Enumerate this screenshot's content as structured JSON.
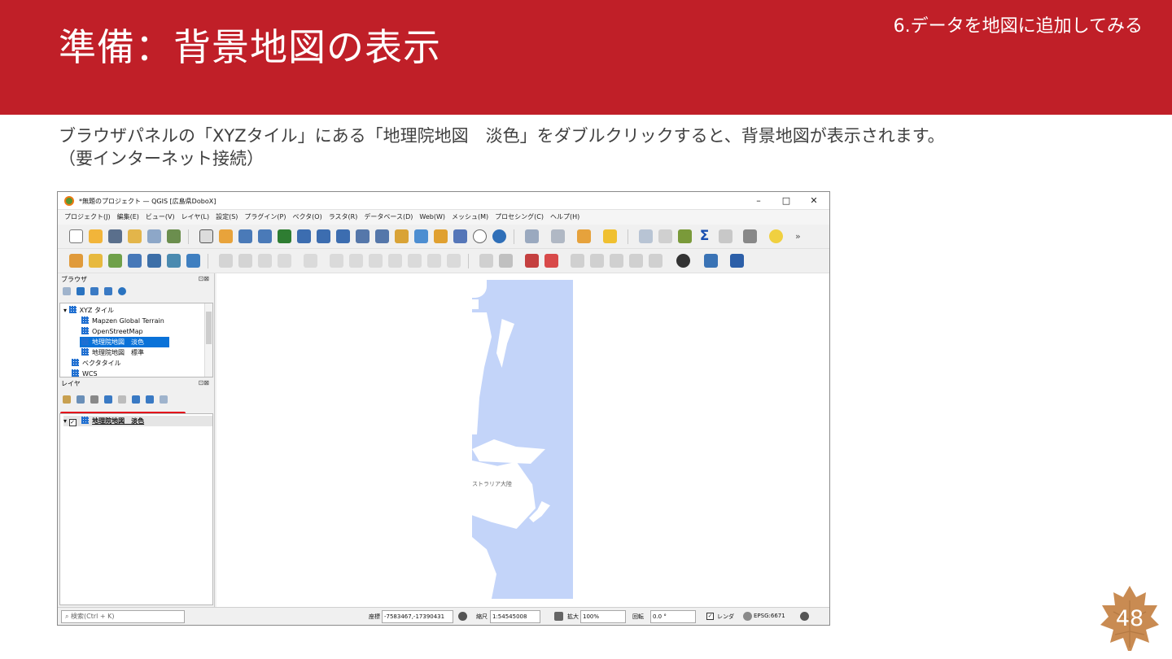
{
  "slide": {
    "title": "準備：背景地図の表示",
    "section": "6.データを地図に追加してみる",
    "description_line1": "ブラウザパネルの「XYZタイル」にある「地理院地図　淡色」をダブルクリックすると、背景地図が表示されます。",
    "description_line2": "（要インターネット接続）",
    "page_number": "48",
    "colors": {
      "header": "#c01f28",
      "badge": "#c98b52",
      "selection": "#0a72d8",
      "highlight_box": "#e3101b",
      "map_sea": "#c3d4f9"
    }
  },
  "window": {
    "title": "*無題のプロジェクト — QGIS [広島県DoboX]",
    "controls": [
      "–",
      "□",
      "✕"
    ]
  },
  "menu": [
    "プロジェクト(J)",
    "編集(E)",
    "ビュー(V)",
    "レイヤ(L)",
    "設定(S)",
    "プラグイン(P)",
    "ベクタ(O)",
    "ラスタ(R)",
    "データベース(D)",
    "Web(W)",
    "メッシュ(M)",
    "プロセシング(C)",
    "ヘルプ(H)"
  ],
  "browser_panel": {
    "title": "ブラウザ",
    "items": {
      "xyz": "XYZ タイル",
      "mapzen": "Mapzen Global Terrain",
      "osm": "OpenStreetMap",
      "gsi": "地理院地図　淡色",
      "gsi_standard": "地理院地図　標準",
      "vector_tiles": "ベクタタイル",
      "wcs": "WCS"
    }
  },
  "layers_panel": {
    "title": "レイヤ",
    "layer": "地理院地図　淡色"
  },
  "map": {
    "label": "ストラリア大陸"
  },
  "statusbar": {
    "search_placeholder": "検索(Ctrl + K)",
    "coord_label": "座標",
    "coord_value": "-7583467,-17390431",
    "scale_label": "縮尺",
    "scale_value": "1:54545008",
    "magnify_label": "拡大",
    "magnify_value": "100%",
    "rotation_label": "回転",
    "rotation_value": "0.0 °",
    "render_label": "レンダ",
    "crs": "EPSG:6671"
  }
}
